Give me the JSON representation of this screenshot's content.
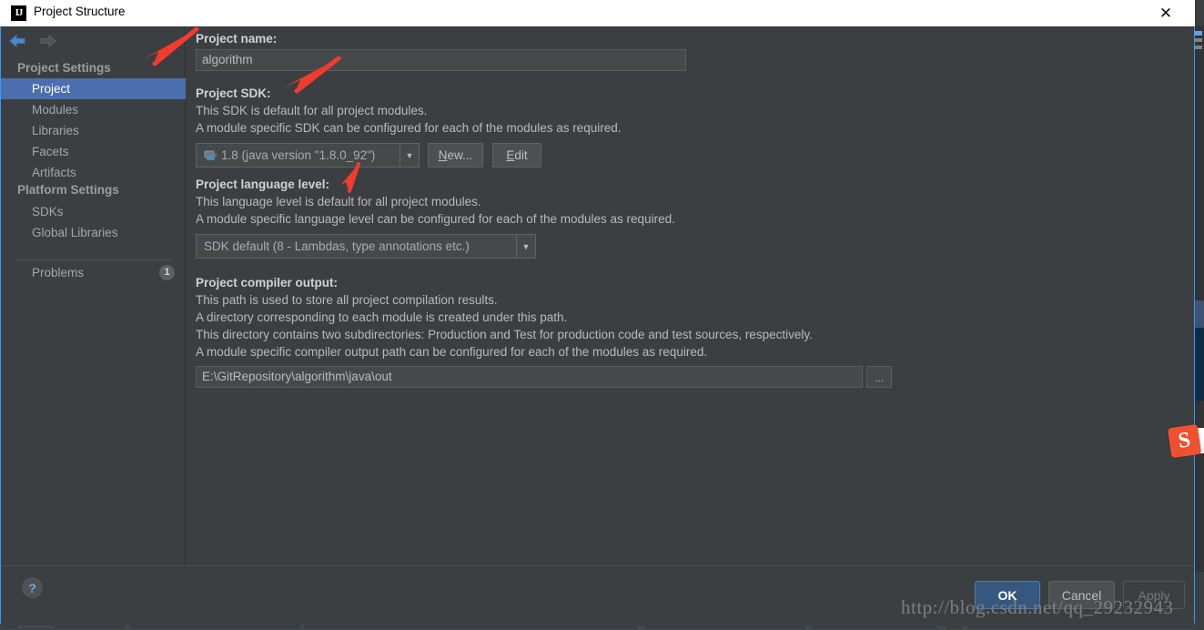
{
  "window": {
    "title": "Project Structure",
    "app_icon": "intellij-idea-icon",
    "close_label": "✕"
  },
  "sidebar": {
    "nav": {
      "back": "back-arrow",
      "forward": "forward-arrow"
    },
    "groups": [
      {
        "label": "Project Settings"
      },
      {
        "label": "Platform Settings"
      }
    ],
    "items": [
      {
        "label": "Project",
        "selected": true
      },
      {
        "label": "Modules",
        "selected": false
      },
      {
        "label": "Libraries",
        "selected": false
      },
      {
        "label": "Facets",
        "selected": false
      },
      {
        "label": "Artifacts",
        "selected": false
      },
      {
        "label": "SDKs",
        "selected": false
      },
      {
        "label": "Global Libraries",
        "selected": false
      }
    ],
    "problems": {
      "label": "Problems",
      "count": "1"
    }
  },
  "panel": {
    "project_name": {
      "label": "Project name:",
      "value": "algorithm"
    },
    "project_sdk": {
      "label": "Project SDK:",
      "desc1": "This SDK is default for all project modules.",
      "desc2": "A module specific SDK can be configured for each of the modules as required.",
      "selected": "1.8 (java version \"1.8.0_92\")",
      "selected_name": "1.8",
      "selected_detail": "(java version \"1.8.0_92\")",
      "new_button": "New...",
      "new_button_mnemonic": "N",
      "new_button_rest": "ew...",
      "edit_button": "Edit",
      "edit_button_mnemonic": "E",
      "edit_button_rest": "dit"
    },
    "language_level": {
      "label": "Project language level:",
      "desc1": "This language level is default for all project modules.",
      "desc2": "A module specific language level can be configured for each of the modules as required.",
      "selected": "SDK default (8 - Lambdas, type annotations etc.)"
    },
    "compiler_output": {
      "label": "Project compiler output:",
      "desc1": "This path is used to store all project compilation results.",
      "desc2": "A directory corresponding to each module is created under this path.",
      "desc3": "This directory contains two subdirectories: Production and Test for production code and test sources, respectively.",
      "desc4": "A module specific compiler output path can be configured for each of the modules as required.",
      "value": "E:\\GitRepository\\algorithm\\java\\out",
      "browse_label": "..."
    }
  },
  "footer": {
    "help": "?",
    "ok": "OK",
    "cancel": "Cancel",
    "apply": "Apply"
  },
  "overlays": {
    "watermark": "http://blog.csdn.net/qq_29232943",
    "ime_logo": "S",
    "annotation_arrows": 3,
    "annotation_color": "#f23b2f"
  },
  "colors": {
    "accent": "#4b6eaf",
    "dialog_bg": "#3c3f41",
    "field_bg": "#45494a",
    "border": "#3399ff",
    "ok_button": "#365880",
    "text": "#b7babc"
  }
}
